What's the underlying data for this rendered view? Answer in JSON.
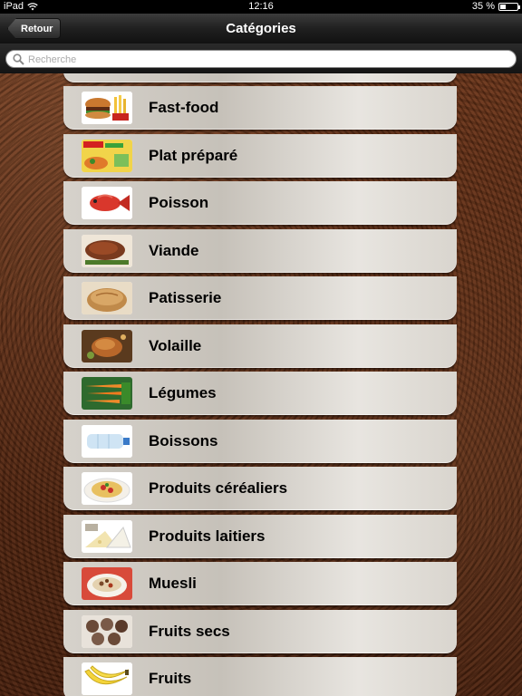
{
  "status": {
    "device": "iPad",
    "time": "12:16",
    "battery": "35 %",
    "battery_level": 0.35
  },
  "nav": {
    "title": "Catégories",
    "back_label": "Retour"
  },
  "search": {
    "placeholder": "Recherche"
  },
  "categories": [
    {
      "label": "Fast-food",
      "icon": "fastfood-icon"
    },
    {
      "label": "Plat préparé",
      "icon": "ready-meal-icon"
    },
    {
      "label": "Poisson",
      "icon": "fish-icon"
    },
    {
      "label": "Viande",
      "icon": "meat-icon"
    },
    {
      "label": "Patisserie",
      "icon": "bread-icon"
    },
    {
      "label": "Volaille",
      "icon": "poultry-icon"
    },
    {
      "label": "Légumes",
      "icon": "carrots-icon"
    },
    {
      "label": "Boissons",
      "icon": "water-bottle-icon"
    },
    {
      "label": "Produits céréaliers",
      "icon": "pasta-icon"
    },
    {
      "label": "Produits laitiers",
      "icon": "cheese-icon"
    },
    {
      "label": "Muesli",
      "icon": "muesli-icon"
    },
    {
      "label": "Fruits secs",
      "icon": "nuts-icon"
    },
    {
      "label": "Fruits",
      "icon": "banana-icon"
    }
  ]
}
